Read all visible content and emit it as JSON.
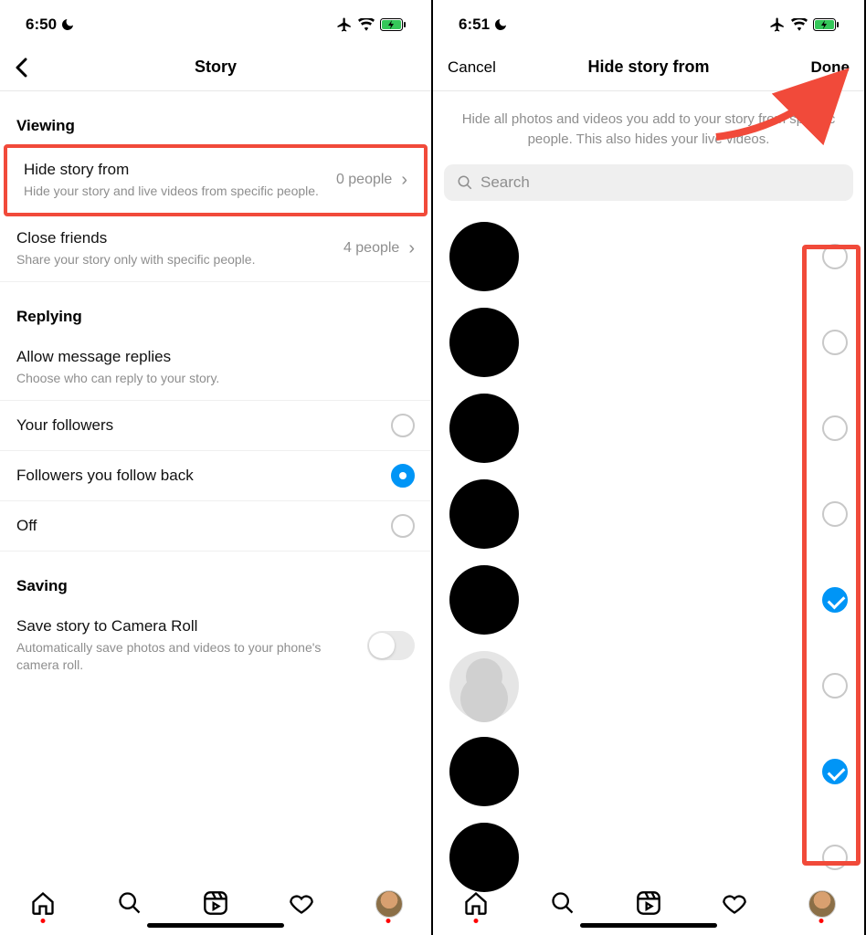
{
  "left": {
    "status_time": "6:50",
    "nav_title": "Story",
    "sections": {
      "viewing": {
        "heading": "Viewing",
        "hide_title": "Hide story from",
        "hide_sub": "Hide your story and live videos from specific people.",
        "hide_value": "0 people",
        "close_title": "Close friends",
        "close_sub": "Share your story only with specific people.",
        "close_value": "4 people"
      },
      "replying": {
        "heading": "Replying",
        "allow_title": "Allow message replies",
        "allow_sub": "Choose who can reply to your story.",
        "opt1": "Your followers",
        "opt2": "Followers you follow back",
        "opt3": "Off"
      },
      "saving": {
        "heading": "Saving",
        "save_title": "Save story to Camera Roll",
        "save_sub": "Automatically save photos and videos to your phone's camera roll."
      }
    }
  },
  "right": {
    "status_time": "6:51",
    "nav_cancel": "Cancel",
    "nav_title": "Hide story from",
    "nav_done": "Done",
    "desc": "Hide all photos and videos you add to your story from specific people. This also hides your live videos.",
    "search_placeholder": "Search",
    "users": [
      {
        "avatar": "black",
        "checked": false
      },
      {
        "avatar": "black",
        "checked": false
      },
      {
        "avatar": "black",
        "checked": false
      },
      {
        "avatar": "black",
        "checked": false
      },
      {
        "avatar": "black",
        "checked": true
      },
      {
        "avatar": "empty",
        "checked": false
      },
      {
        "avatar": "black",
        "checked": true
      },
      {
        "avatar": "black",
        "checked": false
      }
    ]
  },
  "colors": {
    "highlight": "#f14a3a",
    "accent": "#0095f6"
  }
}
